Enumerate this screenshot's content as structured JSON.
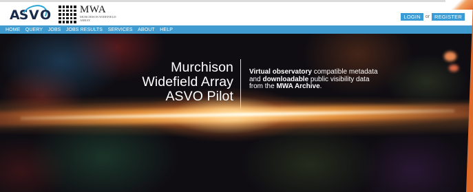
{
  "colors": {
    "accent": "#3f9bd0",
    "button": "#3a9bd5",
    "brand_dark": "#1a2a4a",
    "logo_swoosh": "#2aa6d6"
  },
  "logo": {
    "asvo_text_a": "AS",
    "asvo_text_v": "V",
    "asvo_text_o": "O",
    "mwa_title": "MWA",
    "mwa_subtitle": "Murchison Widefield Array"
  },
  "auth": {
    "login_label": "LOGIN",
    "or_label": "or",
    "register_label": "REGISTER"
  },
  "nav": {
    "items": [
      {
        "label": "HOME"
      },
      {
        "label": "QUERY"
      },
      {
        "label": "JOBS"
      },
      {
        "label": "JOBS RESULTS"
      },
      {
        "label": "SERVICES"
      },
      {
        "label": "ABOUT"
      },
      {
        "label": "HELP"
      }
    ]
  },
  "hero": {
    "title_line1": "Murchison",
    "title_line2": "Widefield Array",
    "title_line3": "ASVO Pilot",
    "desc": {
      "p1_bold": "Virtual observatory",
      "p1_rest": " compatible metadata",
      "p2_pre": "and ",
      "p2_bold": "downloadable",
      "p2_rest": " public visibility data",
      "p3_pre": "from the ",
      "p3_bold": "MWA Archive",
      "p3_rest": "."
    }
  }
}
